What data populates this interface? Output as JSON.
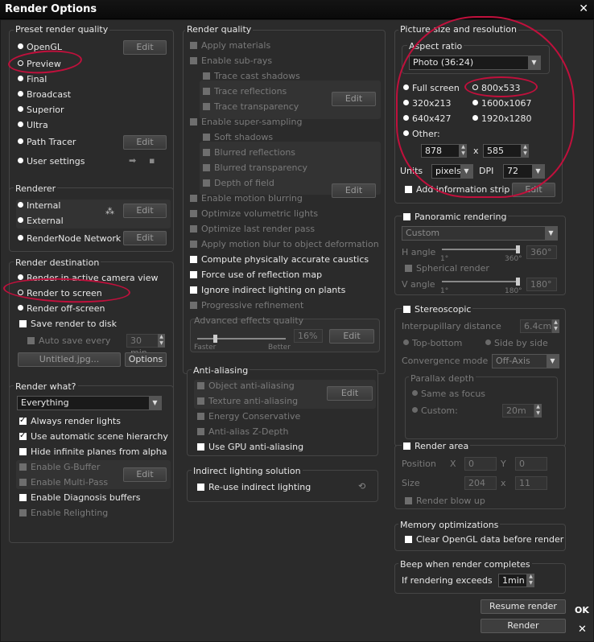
{
  "window": {
    "title": "Render Options",
    "close": "✕"
  },
  "preset": {
    "title": "Preset render quality",
    "items": [
      "OpenGL",
      "Preview",
      "Final",
      "Broadcast",
      "Superior",
      "Ultra",
      "Path Tracer",
      "User settings"
    ],
    "edit": "Edit"
  },
  "renderer": {
    "title": "Renderer",
    "items": [
      "Internal",
      "External",
      "RenderNode Network"
    ],
    "edit": "Edit"
  },
  "destination": {
    "title": "Render destination",
    "items": [
      "Render in active camera view",
      "Render to screen",
      "Render off-screen"
    ],
    "save": "Save render to disk",
    "autosave": "Auto save every",
    "autosave_value": "30 min",
    "file": "Untitled.jpg...",
    "options": "Options"
  },
  "what": {
    "title": "Render what?",
    "select": "Everything",
    "items": [
      "Always render lights",
      "Use automatic scene hierarchy",
      "Hide infinite planes from alpha",
      "Enable G-Buffer",
      "Enable Multi-Pass",
      "Enable Diagnosis buffers",
      "Enable Relighting"
    ],
    "edit": "Edit"
  },
  "quality": {
    "title": "Render quality",
    "items": [
      "Apply materials",
      "Enable sub-rays",
      "Trace cast shadows",
      "Trace reflections",
      "Trace transparency",
      "Enable super-sampling",
      "Soft shadows",
      "Blurred reflections",
      "Blurred transparency",
      "Depth of field",
      "Enable motion blurring",
      "Optimize volumetric lights",
      "Optimize last render pass",
      "Apply motion blur to object deformation",
      "Compute physically accurate caustics",
      "Force use of reflection map",
      "Ignore indirect lighting on plants",
      "Progressive refinement"
    ],
    "edit": "Edit",
    "advanced": "Advanced effects quality",
    "faster": "Faster",
    "better": "Better",
    "percent": "16%"
  },
  "aa": {
    "title": "Anti-aliasing",
    "items": [
      "Object anti-aliasing",
      "Texture anti-aliasing",
      "Energy Conservative",
      "Anti-alias Z-Depth",
      "Use GPU anti-aliasing"
    ],
    "edit": "Edit"
  },
  "indirect": {
    "title": "Indirect lighting solution",
    "item": "Re-use indirect lighting"
  },
  "picture": {
    "title": "Picture size and resolution",
    "aspect_title": "Aspect ratio",
    "aspect": "Photo (36:24)",
    "sizes": [
      "Full screen",
      "800x533",
      "320x213",
      "1600x1067",
      "640x427",
      "1920x1280",
      "Other:"
    ],
    "w": "878",
    "h": "585",
    "x": "x",
    "units_label": "Units",
    "units": "pixels",
    "dpi_label": "DPI",
    "dpi": "72",
    "strip": "Add information strip",
    "edit": "Edit"
  },
  "pano": {
    "title": "Panoramic rendering",
    "select": "Custom",
    "hangle": "H angle",
    "h1": "1°",
    "h2": "360°",
    "hval": "360°",
    "spherical": "Spherical render",
    "vangle": "V angle",
    "v1": "1°",
    "v2": "180°",
    "vval": "180°"
  },
  "stereo": {
    "title": "Stereoscopic",
    "ipd": "Interpupillary distance",
    "ipd_val": "6.4cm",
    "tb": "Top-bottom",
    "sbs": "Side by side",
    "conv": "Convergence mode",
    "conv_val": "Off-Axis",
    "parallax": "Parallax depth",
    "same": "Same as focus",
    "custom": "Custom:",
    "custom_val": "20m"
  },
  "area": {
    "title": "Render area",
    "position": "Position",
    "size": "Size",
    "X": "X",
    "Y": "Y",
    "px": "0",
    "py": "0",
    "sx": "204",
    "sy": "11",
    "x": "x",
    "blow": "Render blow up"
  },
  "memory": {
    "title": "Memory optimizations",
    "item": "Clear OpenGL data before render"
  },
  "beep": {
    "title": "Beep when render completes",
    "label": "If rendering exceeds",
    "val": "1min"
  },
  "actions": {
    "resume": "Resume render",
    "render": "Render",
    "ok": "OK",
    "cancel": "✕"
  },
  "colors": {
    "annotation": "#c0103c",
    "panel": "#2b2b2b"
  }
}
